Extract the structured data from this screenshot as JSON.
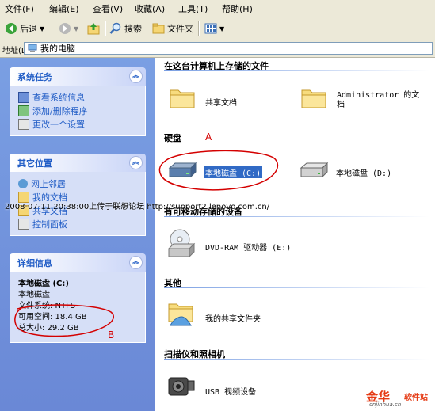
{
  "menu": [
    "文件(F)",
    "编辑(E)",
    "查看(V)",
    "收藏(A)",
    "工具(T)",
    "帮助(H)"
  ],
  "toolbar": {
    "back": "后退",
    "search": "搜索",
    "folders": "文件夹"
  },
  "address": {
    "label": "地址(D)",
    "value": "我的电脑"
  },
  "tasks": {
    "system": {
      "title": "系统任务",
      "items": [
        "查看系统信息",
        "添加/删除程序",
        "更改一个设置"
      ]
    },
    "other": {
      "title": "其它位置",
      "items": [
        "网上邻居",
        "我的文档",
        "共享文档",
        "控制面板"
      ]
    },
    "details": {
      "title": "详细信息",
      "name": "本地磁盘 (C:)",
      "type": "本地磁盘",
      "fs": "文件系统: NTFS",
      "free": "可用空间: 18.4 GB",
      "total": "总大小: 29.2 GB"
    }
  },
  "groups": {
    "stored": {
      "title": "在这台计算机上存储的文件",
      "items": [
        "共享文档",
        "Administrator 的文档"
      ]
    },
    "drives": {
      "title": "硬盘",
      "items": [
        "本地磁盘 (C:)",
        "本地磁盘 (D:)"
      ]
    },
    "removable": {
      "title": "有可移动存储的设备",
      "items": [
        "DVD-RAM 驱动器 (E:)"
      ]
    },
    "other": {
      "title": "其他",
      "items": [
        "我的共享文件夹"
      ]
    },
    "scanners": {
      "title": "扫描仪和照相机",
      "items": [
        "USB 视频设备"
      ]
    }
  },
  "annotations": {
    "a": "A",
    "b": "B"
  },
  "watermark": "2008-07-11 20:38:00上传于联想论坛 http://support2.lenovo.com.cn/",
  "logo": {
    "main": "金华",
    "sub": "软件站",
    "url": "cnjinhua.cn"
  },
  "colors": {
    "accent": "#215dc6",
    "pane": "#7a9fe3",
    "annotation": "#d40000"
  }
}
